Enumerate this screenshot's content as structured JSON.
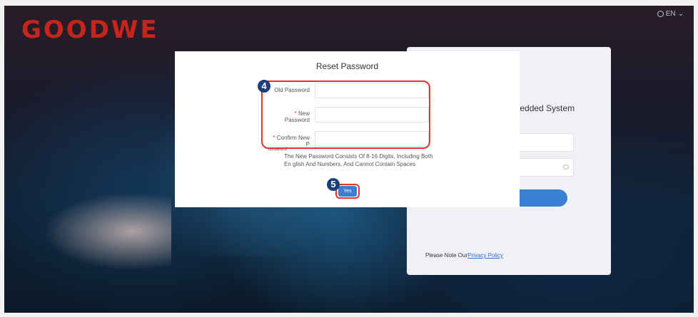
{
  "brand": {
    "logo_text": "GOODWE",
    "logo_color": "#c8241c"
  },
  "language": {
    "label": "EN",
    "icon": "globe-icon",
    "chevron": "chevron-down-icon"
  },
  "login_card": {
    "title_fragment": "nbedded System",
    "privacy_prefix": "Please Note Our",
    "privacy_link": "Privacy Policy"
  },
  "modal": {
    "title": "Reset Password",
    "required_mark": "*",
    "fields": [
      {
        "label": "Old Password",
        "value": ""
      },
      {
        "label": "New Password",
        "value": ""
      },
      {
        "label": "Confirm New P",
        "label_tail": "assword",
        "value": ""
      }
    ],
    "hint": "The New Password Consists Of 8-16 Digits, Including Both En glish And Numbers, And Cannot Contain Spaces",
    "yes_label": "Yes"
  },
  "annotations": {
    "step4": "4",
    "step5": "5",
    "highlight_color": "#e5322d",
    "badge_color": "#1c3f7a"
  },
  "colors": {
    "accent": "#3a7fd1"
  }
}
